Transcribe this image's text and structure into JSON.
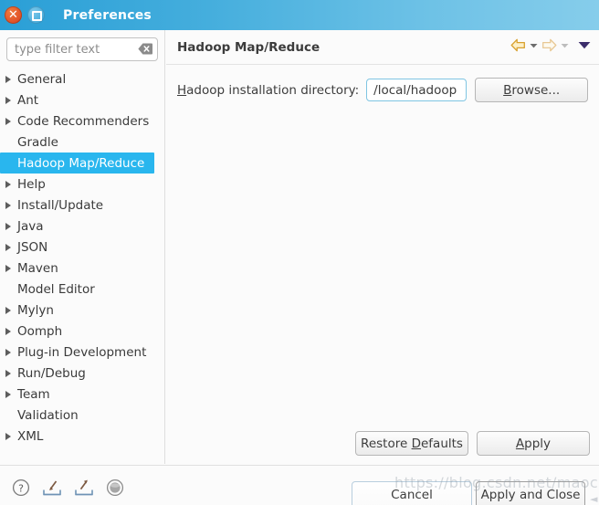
{
  "window": {
    "title": "Preferences",
    "controls": {
      "close": "close-button",
      "maximize": "maximize-button"
    }
  },
  "sidebar": {
    "filter": {
      "placeholder": "type filter text",
      "value": "",
      "clear_icon": "clear-icon"
    },
    "items": [
      {
        "label": "General",
        "expandable": true,
        "selected": false
      },
      {
        "label": "Ant",
        "expandable": true,
        "selected": false
      },
      {
        "label": "Code Recommenders",
        "expandable": true,
        "selected": false
      },
      {
        "label": "Gradle",
        "expandable": false,
        "selected": false
      },
      {
        "label": "Hadoop Map/Reduce",
        "expandable": false,
        "selected": true
      },
      {
        "label": "Help",
        "expandable": true,
        "selected": false
      },
      {
        "label": "Install/Update",
        "expandable": true,
        "selected": false
      },
      {
        "label": "Java",
        "expandable": true,
        "selected": false
      },
      {
        "label": "JSON",
        "expandable": true,
        "selected": false
      },
      {
        "label": "Maven",
        "expandable": true,
        "selected": false
      },
      {
        "label": "Model Editor",
        "expandable": false,
        "selected": false
      },
      {
        "label": "Mylyn",
        "expandable": true,
        "selected": false
      },
      {
        "label": "Oomph",
        "expandable": true,
        "selected": false
      },
      {
        "label": "Plug-in Development",
        "expandable": true,
        "selected": false
      },
      {
        "label": "Run/Debug",
        "expandable": true,
        "selected": false
      },
      {
        "label": "Team",
        "expandable": true,
        "selected": false
      },
      {
        "label": "Validation",
        "expandable": false,
        "selected": false
      },
      {
        "label": "XML",
        "expandable": true,
        "selected": false
      }
    ]
  },
  "content": {
    "page_title": "Hadoop Map/Reduce",
    "nav": {
      "back_icon": "back-arrow-icon",
      "back_menu_icon": "chevron-down-icon",
      "forward_icon": "forward-arrow-icon",
      "forward_menu_icon": "chevron-down-icon",
      "view_menu_icon": "chevron-down-icon"
    },
    "field": {
      "label_before": "H",
      "label_after": "adoop installation directory:",
      "value": "/local/hadoop",
      "placeholder": ""
    },
    "browse_label_before": "B",
    "browse_label_after": "rowse...",
    "restore_label_before": "Restore ",
    "restore_label_mn": "D",
    "restore_label_after": "efaults",
    "apply_label_mn": "A",
    "apply_label_after": "pply"
  },
  "footer": {
    "icons": [
      {
        "name": "help-icon"
      },
      {
        "name": "import-icon"
      },
      {
        "name": "export-icon"
      },
      {
        "name": "sphere-icon"
      }
    ],
    "cancel_label": "Cancel",
    "apply_close_label": "Apply and Close"
  },
  "watermark": {
    "text": "https://blog.csdn.net/maochaofei",
    "corner": "◄"
  },
  "colors": {
    "titlebar_left": "#2a9fd6",
    "titlebar_right": "#86cdeb",
    "selection": "#29b6ee",
    "field_focus_border": "#7fc5e2",
    "close_button": "#e2562a",
    "nav_arrow": "#e0a33a"
  }
}
